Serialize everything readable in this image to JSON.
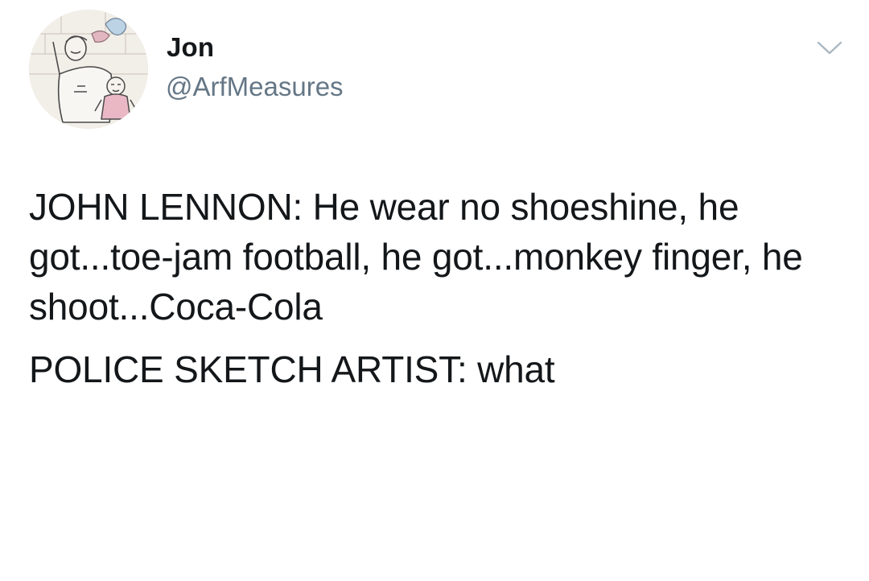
{
  "user": {
    "display_name": "Jon",
    "handle": "@ArfMeasures",
    "avatar_icon": "sketch-avatar-icon"
  },
  "menu": {
    "icon": "chevron-down-icon"
  },
  "tweet": {
    "paragraphs": [
      "JOHN LENNON: He wear no shoeshine, he got...toe-jam football, he got...monkey finger, he shoot...Coca-Cola",
      "POLICE SKETCH ARTIST: what"
    ]
  },
  "colors": {
    "text": "#14171a",
    "handle": "#657786",
    "caret": "#aab8c2"
  }
}
